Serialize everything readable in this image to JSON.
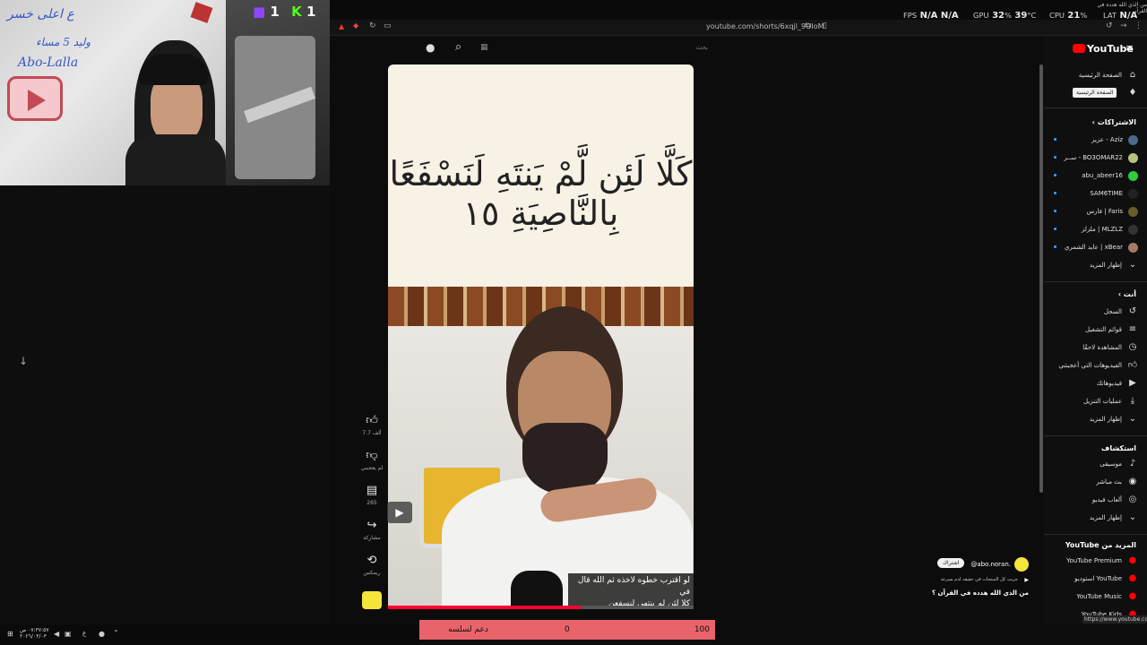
{
  "system": {
    "fps_label": "FPS",
    "fps_value": "N/A",
    "fps_value2": "N/A",
    "gpu_label": "GPU",
    "gpu_value": "32",
    "gpu_unit": "%",
    "gpu_temp": "39",
    "gpu_temp_unit": "°C",
    "cpu_label": "CPU",
    "cpu_value": "21",
    "cpu_unit": "%",
    "lat_label": "LAT",
    "lat_value": "N/A"
  },
  "browser": {
    "url": "youtube.com/shorts/6xqjl_9OIoM",
    "tab_title": "من الذي الله هدده في القرآن"
  },
  "webcam": {
    "counter_k": "1",
    "counter_t": "1",
    "whiteboard_name": "Abo-Lalla"
  },
  "youtube": {
    "logo_text": "YouTube",
    "search_placeholder": "بحث",
    "video": {
      "verse": "كَلَّا لَئِن لَّمْ يَنتَهِ لَنَسْفَعًا بِالنَّاصِيَةِ ١٥",
      "subtitle_line1": "لو اقترب خطوه لاخذه ثم الله قال في",
      "subtitle_line2": "كلا لئن لم ينتهي لنسفعن"
    },
    "actions": {
      "likes": "7.7 ألف",
      "dislike": "لم يعجبني",
      "comments": "265",
      "share": "مشاركة",
      "remix": "ريمكس"
    },
    "channel": {
      "handle": "@abo.noran.",
      "subscribe": "اشتراك",
      "desc": "جربت كل المنتجات في حقيقه لدم بسرعه",
      "title": "من الذي الله هدده في القرآن ؟"
    },
    "sidebar": {
      "home": "الصفحة الرئيسية",
      "shorts": "Shorts",
      "tooltip": "الصفحة الرئيسية",
      "subscriptions_head": "الاشتراكات",
      "subs": [
        "Aziz - عزيز",
        "BO3OMAR22 - ســر",
        "abu_abeer16",
        "SAM6TIME",
        "Faris | فارس",
        "MLZLZ | ملزلز",
        "xBear | عايد الشمري"
      ],
      "show_more": "إظهار المزيد",
      "you_head": "أنت",
      "you": [
        "السجل",
        "قوائم التشغيل",
        "المشاهدة لاحقًا",
        "الفيديوهات التي أعجبتني",
        "فيديوهاتك",
        "عمليات التنزيل"
      ],
      "show_more2": "إظهار المزيد",
      "explore_head": "استكشاف",
      "explore": [
        "موسيقى",
        "بث مباشر",
        "ألعاب فيديو"
      ],
      "show_more3": "إظهار المزيد",
      "more_head": "المزيد من YouTube",
      "more": [
        "YouTube Premium",
        "YouTube استوديو",
        "YouTube Music",
        "YouTube Kids"
      ]
    },
    "status_url": "https://www.youtube.com"
  },
  "donation": {
    "label": "دعم لسلسه",
    "current": "0",
    "goal": "100"
  },
  "taskbar": {
    "time": "٠٧:٣٧:٥٧ ص",
    "date": "٢٠٢٦/٠٣/٠٣",
    "lang": "ع"
  },
  "colors": {
    "accent": "#ff0000",
    "donation": "#e8646a",
    "link_dot": "#3ea6ff"
  }
}
